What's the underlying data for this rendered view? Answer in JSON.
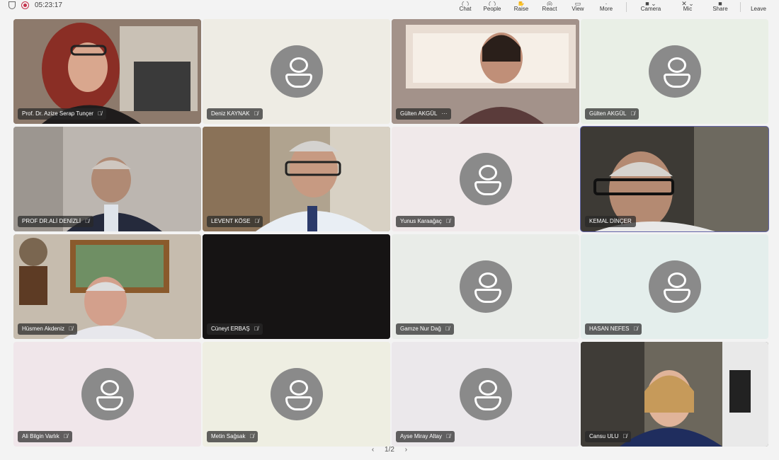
{
  "meeting": {
    "elapsed": "05:23:17"
  },
  "toolbar": [
    {
      "label": "Chat",
      "icon": "chat-icon"
    },
    {
      "label": "People",
      "icon": "people-icon"
    },
    {
      "label": "Raise",
      "icon": "raise-hand-icon"
    },
    {
      "label": "React",
      "icon": "react-icon"
    },
    {
      "label": "View",
      "icon": "view-icon"
    },
    {
      "label": "More",
      "icon": "more-icon"
    },
    {
      "label": "Camera",
      "icon": "camera-icon"
    },
    {
      "label": "Mic",
      "icon": "mic-icon"
    },
    {
      "label": "Share",
      "icon": "share-icon"
    },
    {
      "label": "Leave",
      "icon": "leave-icon"
    }
  ],
  "participants": [
    {
      "name": "Prof. Dr. Azize Serap Tunçer",
      "video": true,
      "muted": true,
      "bg": "#7a6658"
    },
    {
      "name": "Deniz KAYNAK",
      "video": false,
      "muted": true,
      "bg": "#eeece4"
    },
    {
      "name": "Gülten AKGÜL",
      "video": true,
      "muted": false,
      "more": "···",
      "bg": "#9a8a82"
    },
    {
      "name": "Gülten AKGÜL",
      "video": false,
      "muted": true,
      "bg": "#e9efe6"
    },
    {
      "name": "PROF DR.ALİ DENİZLİ",
      "video": true,
      "muted": true,
      "bg": "#b9b3ae"
    },
    {
      "name": "LEVENT KÖSE",
      "video": true,
      "muted": true,
      "bg": "#a89a86"
    },
    {
      "name": "Yunus Karaağaç",
      "video": false,
      "muted": true,
      "bg": "#f0e9ea"
    },
    {
      "name": "KEMAL DİNÇER",
      "video": true,
      "muted": false,
      "active": true,
      "bg": "#4c4a44"
    },
    {
      "name": "Hüsmen Akdeniz",
      "video": true,
      "muted": true,
      "bg": "#c3b7a8"
    },
    {
      "name": "Cüneyt ERBAŞ",
      "video": true,
      "muted": true,
      "bg": "#161414"
    },
    {
      "name": "Gamze Nur Dağ",
      "video": false,
      "muted": true,
      "bg": "#e9ece8"
    },
    {
      "name": "HASAN NEFES",
      "video": false,
      "muted": true,
      "bg": "#e4eeec"
    },
    {
      "name": "Ali Bilgin Varlık",
      "video": false,
      "muted": true,
      "bg": "#f0e6ea"
    },
    {
      "name": "Metin Sağsak",
      "video": false,
      "muted": true,
      "bg": "#eeeee2"
    },
    {
      "name": "Ayse Miray Altay",
      "video": false,
      "muted": true,
      "bg": "#ebe8eb"
    },
    {
      "name": "Cansu ULU",
      "video": true,
      "muted": true,
      "bg": "#5c574e"
    }
  ],
  "pager": {
    "current": "1/2"
  }
}
